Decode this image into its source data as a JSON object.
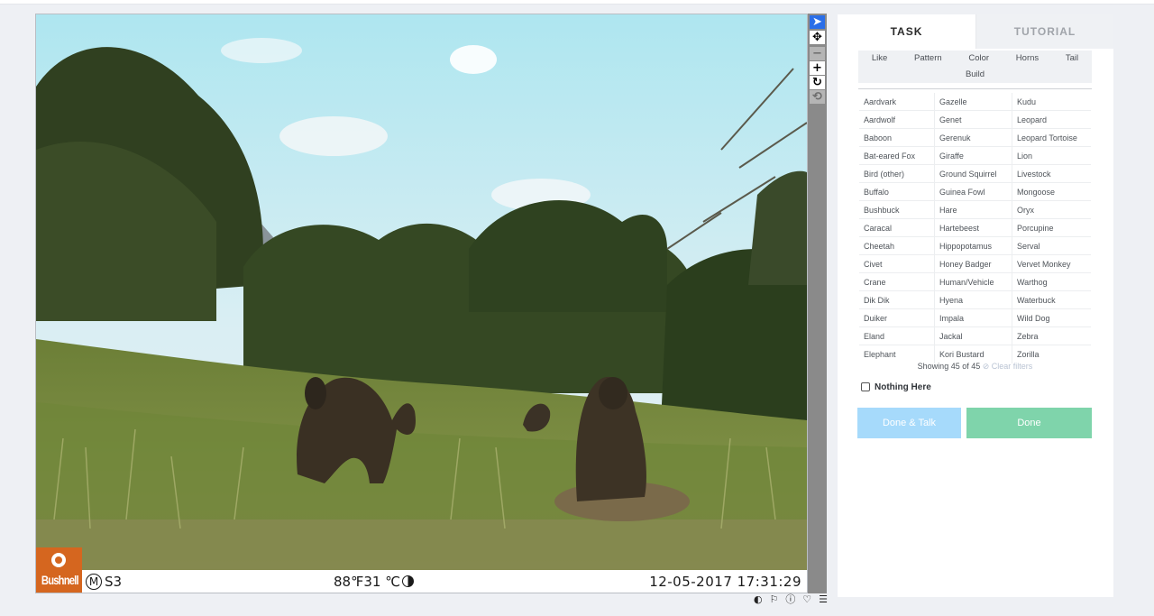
{
  "colors": {
    "accent": "#2a6ee8",
    "done_talk": "#a6dafb",
    "done": "#7fd4ab",
    "logo": "#d5661f"
  },
  "camera": {
    "brand": "Bushnell",
    "m_symbol": "M",
    "camera_id": "S3",
    "temperature": "88℉31 ℃",
    "datetime": "12-05-2017 17:31:29"
  },
  "tools": [
    {
      "name": "pointer-icon",
      "glyph": "➤"
    },
    {
      "name": "pan-icon",
      "glyph": "✥"
    },
    {
      "name": "zoom-out-icon",
      "glyph": "−"
    },
    {
      "name": "zoom-in-icon",
      "glyph": "+"
    },
    {
      "name": "rotate-icon",
      "glyph": "↻"
    },
    {
      "name": "reset-icon",
      "glyph": "⟲"
    }
  ],
  "subject_icons": [
    "contrast-icon",
    "flag-icon",
    "info-icon",
    "heart-icon",
    "list-icon"
  ],
  "tabs": {
    "task": "TASK",
    "tutorial": "TUTORIAL"
  },
  "filters": {
    "row1": [
      "Like",
      "Pattern",
      "Color",
      "Horns",
      "Tail"
    ],
    "row2": [
      "Build"
    ]
  },
  "choices": [
    [
      "Aardvark",
      "Gazelle",
      "Kudu"
    ],
    [
      "Aardwolf",
      "Genet",
      "Leopard"
    ],
    [
      "Baboon",
      "Gerenuk",
      "Leopard Tortoise"
    ],
    [
      "Bat-eared Fox",
      "Giraffe",
      "Lion"
    ],
    [
      "Bird (other)",
      "Ground Squirrel",
      "Livestock"
    ],
    [
      "Buffalo",
      "Guinea Fowl",
      "Mongoose"
    ],
    [
      "Bushbuck",
      "Hare",
      "Oryx"
    ],
    [
      "Caracal",
      "Hartebeest",
      "Porcupine"
    ],
    [
      "Cheetah",
      "Hippopotamus",
      "Serval"
    ],
    [
      "Civet",
      "Honey Badger",
      "Vervet Monkey"
    ],
    [
      "Crane",
      "Human/Vehicle",
      "Warthog"
    ],
    [
      "Dik Dik",
      "Hyena",
      "Waterbuck"
    ],
    [
      "Duiker",
      "Impala",
      "Wild Dog"
    ],
    [
      "Eland",
      "Jackal",
      "Zebra"
    ],
    [
      "Elephant",
      "Kori Bustard",
      "Zorilla"
    ]
  ],
  "showing": {
    "text": "Showing 45 of 45",
    "clear": "⊘ Clear filters"
  },
  "nothing_here": "Nothing Here",
  "buttons": {
    "done_talk": "Done & Talk",
    "done": "Done"
  }
}
